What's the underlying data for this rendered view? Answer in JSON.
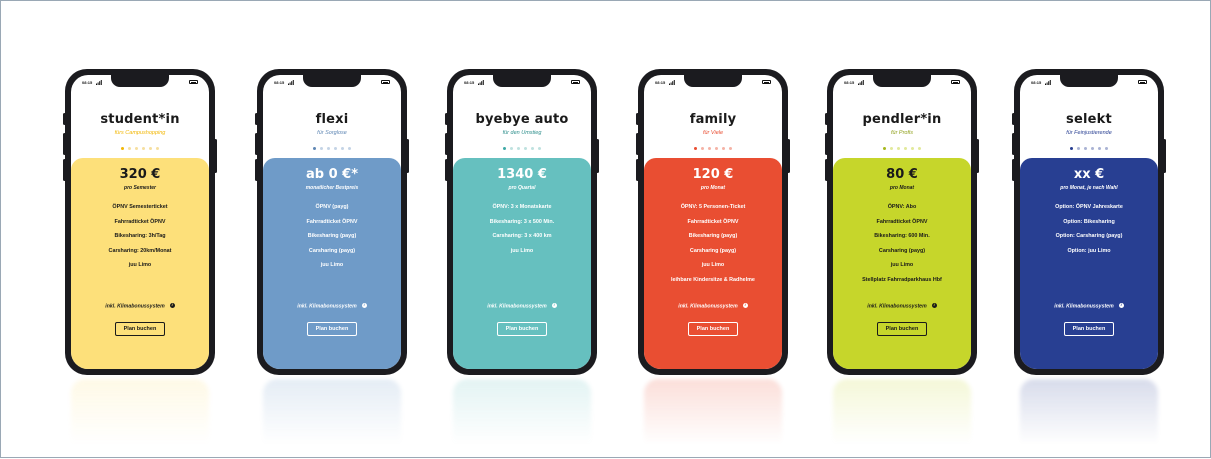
{
  "status_time": "08:15",
  "plans": [
    {
      "title": "student*in",
      "subtitle": "fürs Campushopping",
      "active_dot": 0,
      "price": "320 €",
      "price_sub": "pro Semester",
      "features": [
        "ÖPNV Semesterticket",
        "Fahrradticket ÖPNV",
        "Bikesharing: 3h/Tag",
        "Carsharing: 20km/Monat",
        "juu Limo"
      ],
      "bonus": "inkl. Klimabonussystem",
      "button": "Plan buchen",
      "colors": {
        "card": "#fde07a",
        "text": "#1a1a1a",
        "subtitle": "#f2b705",
        "dot_active": "#f2b705",
        "dot": "#f6dfa0",
        "button_border": "#1a1a1a"
      }
    },
    {
      "title": "flexi",
      "subtitle": "für Sorglose",
      "active_dot": 0,
      "price": "ab 0 €*",
      "price_sub": "monatlicher Bestpreis",
      "features": [
        "ÖPNV (payg)",
        "Fahrradticket ÖPNV",
        "Bikesharing (payg)",
        "Carsharing (payg)",
        "juu Limo"
      ],
      "bonus": "inkl. Klimabonussystem",
      "button": "Plan buchen",
      "colors": {
        "card": "#6f9bc8",
        "text": "#ffffff",
        "subtitle": "#5f87b4",
        "dot_active": "#5f87b4",
        "dot": "#c4d4e6",
        "button_border": "#ffffff"
      }
    },
    {
      "title": "byebye auto",
      "subtitle": "für den Umstieg",
      "active_dot": 0,
      "price": "1340 €",
      "price_sub": "pro Quartal",
      "features": [
        "ÖPNV: 3 x Monatskarte",
        "Bikesharing: 3 x 500 Min.",
        "Carsharing: 3 x 400 km",
        "juu Limo"
      ],
      "bonus": "inkl. Klimabonussystem",
      "button": "Plan buchen",
      "colors": {
        "card": "#66c0bf",
        "text": "#ffffff",
        "subtitle": "#2e8f8c",
        "dot_active": "#3fa9a6",
        "dot": "#bfe2e0",
        "button_border": "#ffffff"
      }
    },
    {
      "title": "family",
      "subtitle": "für Viele",
      "active_dot": 0,
      "price": "120 €",
      "price_sub": "pro Monat",
      "features": [
        "ÖPNV: 5 Personen-Ticket",
        "Fahrradticket ÖPNV",
        "Bikesharing (payg)",
        "Carsharing (payg)",
        "juu Limo",
        "leihbare Kindersitze & Radhelme"
      ],
      "bonus": "inkl. Klimabonussystem",
      "button": "Plan buchen",
      "colors": {
        "card": "#e94e32",
        "text": "#ffffff",
        "subtitle": "#e94e32",
        "dot_active": "#e94e32",
        "dot": "#f5b3a6",
        "button_border": "#ffffff"
      }
    },
    {
      "title": "pendler*in",
      "subtitle": "für Profis",
      "active_dot": 0,
      "price": "80 €",
      "price_sub": "pro Monat",
      "features": [
        "ÖPNV: Abo",
        "Fahrradticket ÖPNV",
        "Bikesharing: 600 Min.",
        "Carsharing (payg)",
        "juu Limo",
        "Stellplatz Fahrradparkhaus Hbf"
      ],
      "bonus": "inkl. Klimabonussystem",
      "button": "Plan buchen",
      "colors": {
        "card": "#c6d62b",
        "text": "#1a1a1a",
        "subtitle": "#8fa01a",
        "dot_active": "#a6b81d",
        "dot": "#e2ea9c",
        "button_border": "#1a1a1a"
      }
    },
    {
      "title": "selekt",
      "subtitle": "für Feinjustierende",
      "active_dot": 0,
      "price": "xx €",
      "price_sub": "pro Monat, je nach Wahl",
      "features": [
        "Option: ÖPNV Jahreskarte",
        "Option: Bikesharing",
        "Option: Carsharing (payg)",
        "Option: juu Limo"
      ],
      "bonus": "inkl. Klimabonussystem",
      "button": "Plan buchen",
      "colors": {
        "card": "#283f92",
        "text": "#ffffff",
        "subtitle": "#283f92",
        "dot_active": "#283f92",
        "dot": "#aab3d4",
        "button_border": "#ffffff"
      }
    }
  ]
}
